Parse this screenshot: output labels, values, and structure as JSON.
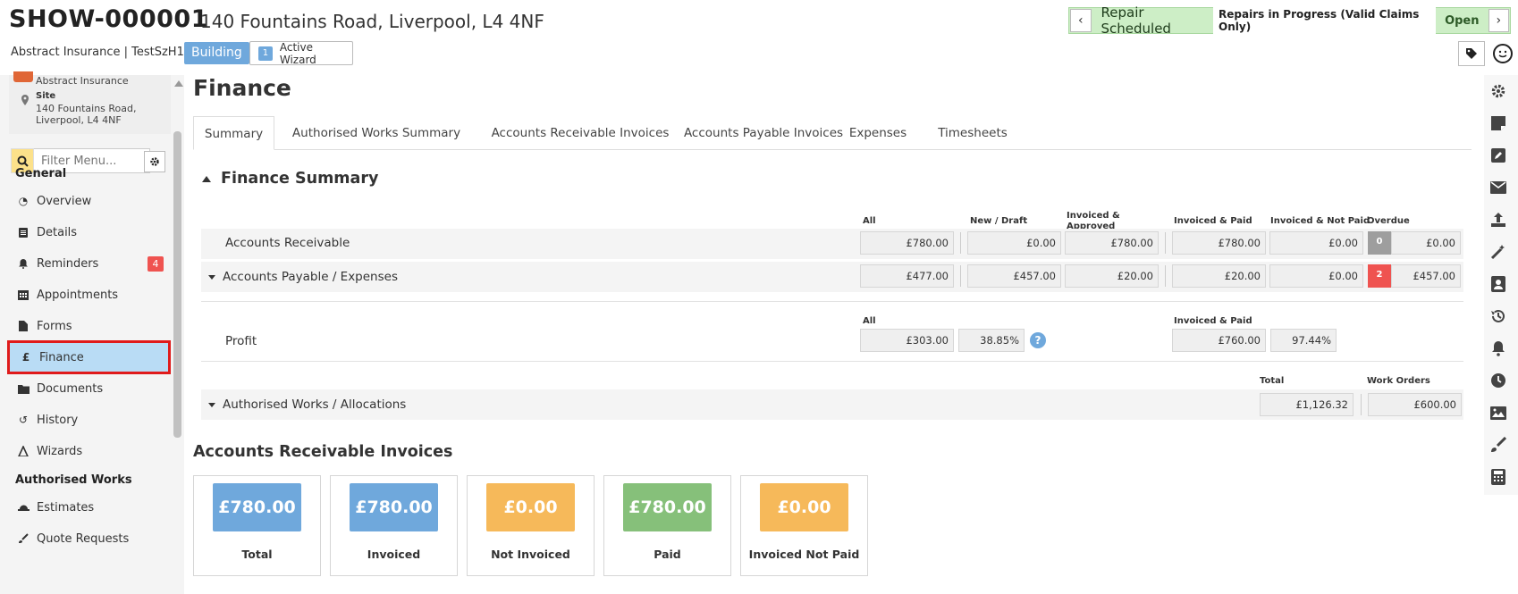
{
  "header": {
    "job_id": "SHOW-000001",
    "address": "140 Fountains Road, Liverpool, L4 4NF",
    "client_line": "Abstract Insurance | TestSzH1",
    "type_badge": "Building",
    "wizard_count": "1",
    "wizard_label": "Active Wizard",
    "status": "Repair Scheduled",
    "sub_status": "Repairs in Progress (Valid Claims Only)",
    "state": "Open"
  },
  "sidebar": {
    "insurer": "Abstract Insurance",
    "site_label": "Site",
    "site_address": "140 Fountains Road, Liverpool, L4 4NF",
    "filter_placeholder": "Filter Menu...",
    "general_heading": "General",
    "items": [
      {
        "label": "Overview",
        "icon": "dashboard-icon"
      },
      {
        "label": "Details",
        "icon": "clipboard-icon"
      },
      {
        "label": "Reminders",
        "icon": "bell-icon",
        "count": "4"
      },
      {
        "label": "Appointments",
        "icon": "calendar-icon"
      },
      {
        "label": "Forms",
        "icon": "file-icon"
      },
      {
        "label": "Finance",
        "icon": "pound-icon",
        "active": true
      },
      {
        "label": "Documents",
        "icon": "folder-icon"
      },
      {
        "label": "History",
        "icon": "history-icon"
      },
      {
        "label": "Wizards",
        "icon": "wizard-icon"
      }
    ],
    "authorised_heading": "Authorised Works",
    "items2": [
      {
        "label": "Estimates",
        "icon": "hardhat-icon"
      },
      {
        "label": "Quote Requests",
        "icon": "brush-icon"
      }
    ]
  },
  "page": {
    "title": "Finance",
    "tabs": [
      "Summary",
      "Authorised Works Summary",
      "Accounts Receivable Invoices",
      "Accounts Payable Invoices",
      "Expenses",
      "Timesheets"
    ],
    "summary_title": "Finance Summary",
    "columns": {
      "all": "All",
      "new_draft": "New / Draft",
      "invoiced_approved": "Invoiced & Approved",
      "invoiced_paid": "Invoiced & Paid",
      "invoiced_not_paid": "Invoiced & Not Paid",
      "overdue": "Overdue"
    },
    "ar": {
      "label": "Accounts Receivable",
      "all": "£780.00",
      "new_draft": "£0.00",
      "invoiced_approved": "£780.00",
      "invoiced_paid": "£780.00",
      "invoiced_not_paid": "£0.00",
      "overdue_count": "0",
      "overdue": "£0.00"
    },
    "ap": {
      "label": "Accounts Payable / Expenses",
      "all": "£477.00",
      "new_draft": "£457.00",
      "invoiced_approved": "£20.00",
      "invoiced_paid": "£20.00",
      "invoiced_not_paid": "£0.00",
      "overdue_count": "2",
      "overdue": "£457.00"
    },
    "profit": {
      "label": "Profit",
      "all_header": "All",
      "paid_header": "Invoiced & Paid",
      "all": "£303.00",
      "all_pct": "38.85%",
      "paid": "£760.00",
      "paid_pct": "97.44%"
    },
    "aw": {
      "label": "Authorised Works / Allocations",
      "total_header": "Total",
      "wo_header": "Work Orders",
      "total": "£1,126.32",
      "work_orders": "£600.00"
    },
    "ari_title": "Accounts Receivable Invoices",
    "cards": [
      {
        "value": "£780.00",
        "label": "Total",
        "color": "#6fa8dc"
      },
      {
        "value": "£780.00",
        "label": "Invoiced",
        "color": "#6fa8dc"
      },
      {
        "value": "£0.00",
        "label": "Not Invoiced",
        "color": "#f6b95a"
      },
      {
        "value": "£780.00",
        "label": "Paid",
        "color": "#86c07a"
      },
      {
        "value": "£0.00",
        "label": "Invoiced Not Paid",
        "color": "#f6b95a"
      }
    ]
  },
  "rail_icons": [
    "gear-icon",
    "note-icon",
    "edit-icon",
    "envelope-icon",
    "upload-icon",
    "magic-icon",
    "contact-icon",
    "history-icon",
    "bell-icon",
    "clock-icon",
    "image-icon",
    "brush-icon",
    "calculator-icon"
  ],
  "colors": {
    "accent": "#6fa8dc",
    "status_bg": "#cdeec6",
    "danger": "#ef5350",
    "active_item": "#b9dcf5"
  }
}
